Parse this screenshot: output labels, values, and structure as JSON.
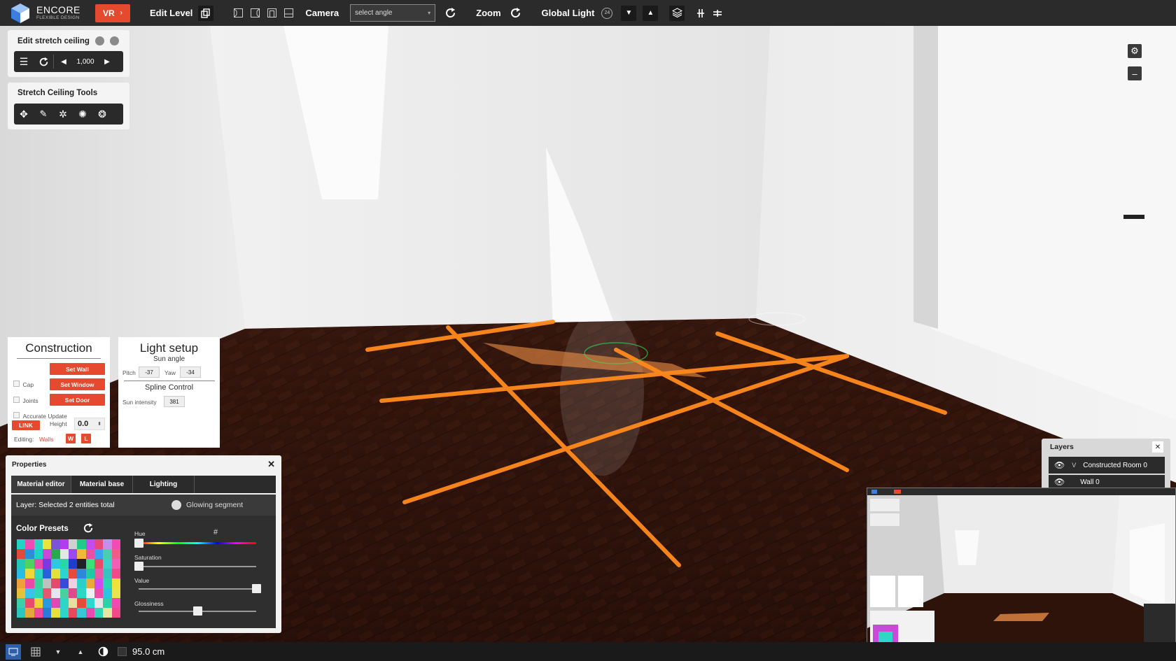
{
  "app": {
    "name": "ENCORE",
    "tagline": "FLEXIBLE DESIGN"
  },
  "toolbar": {
    "vr_label": "VR",
    "edit_level_label": "Edit Level",
    "camera_label": "Camera",
    "camera_select_value": "select angle",
    "zoom_label": "Zoom",
    "global_light_label": "Global Light",
    "global_light_badge": "24"
  },
  "edit_stretch": {
    "title": "Edit stretch ceiling",
    "value": "1,000"
  },
  "stretch_tools": {
    "title": "Stretch Ceiling Tools"
  },
  "construction": {
    "title": "Construction",
    "set_wall": "Set Wall",
    "set_window": "Set Window",
    "set_door": "Set Door",
    "cap_label": "Cap",
    "joints_label": "Joints",
    "accurate_label": "Accurate Update",
    "link_label": "LINK",
    "height_label": "Height",
    "height_value": "0.0",
    "editing_label": "Editing:",
    "editing_value": "Walls",
    "w_label": "W",
    "l_label": "L"
  },
  "light_setup": {
    "title": "Light setup",
    "sun_angle": "Sun angle",
    "pitch_label": "Pitch",
    "pitch_value": "-37",
    "yaw_label": "Yaw",
    "yaw_value": "-34",
    "spline_label": "Spline Control",
    "sun_intensity_label": "Sun intensity",
    "sun_intensity_value": "381"
  },
  "properties": {
    "title": "Properties",
    "tabs": [
      "Material editor",
      "Material base",
      "Lighting"
    ],
    "layer_text": "Layer: Selected 2 entities total",
    "glowing_label": "Glowing segment",
    "color_presets_label": "Color Presets",
    "hue_label": "Hue",
    "hash_label": "#",
    "saturation_label": "Saturation",
    "value_label": "Value",
    "glossiness_label": "Glossiness",
    "hue": 0.0,
    "saturation": 0.0,
    "value": 1.0,
    "glossiness": 0.5,
    "swatches": [
      "#1fd6c6",
      "#f04bb5",
      "#2fd2c7",
      "#e8e43a",
      "#7a53d8",
      "#b33cf0",
      "#d0d0d0",
      "#21c98a",
      "#c74af0",
      "#e64878",
      "#c58eea",
      "#f24bb3",
      "#e34a3a",
      "#2a8fd8",
      "#1ed5c3",
      "#c94ad8",
      "#2aa94a",
      "#e6e6e6",
      "#9c4af0",
      "#f5b63a",
      "#e84fa8",
      "#3aa2f0",
      "#47d0b0",
      "#f05b8a",
      "#23c9b8",
      "#50d25f",
      "#e64bb0",
      "#7a3ae0",
      "#31c7e0",
      "#2ad6a8",
      "#1f3ed0",
      "#20202a",
      "#3ae078",
      "#e84a6a",
      "#3dd1c9",
      "#f05fb5",
      "#2bbbe6",
      "#f0d63a",
      "#2fd6c0",
      "#2a60d8",
      "#e6e03a",
      "#2fd3d0",
      "#e64a3a",
      "#2a8ad8",
      "#20c9a0",
      "#e65aa8",
      "#34c5c0",
      "#f04a8a",
      "#f0a03a",
      "#e84aa6",
      "#3ad29a",
      "#c0c0c0",
      "#e64a6a",
      "#3a4ad8",
      "#f0d0e0",
      "#29d0c8",
      "#e8a83a",
      "#d04af0",
      "#2ad6b0",
      "#f0e03a",
      "#e8c03a",
      "#3ac2e8",
      "#2fd6b6",
      "#e6586e",
      "#e6e6f0",
      "#4ad0a0",
      "#e04a8a",
      "#2fd6c6",
      "#eeeeee",
      "#f04aa8",
      "#2ac6e0",
      "#e6e64a",
      "#3ad0a8",
      "#e84a6a",
      "#f0d03a",
      "#2a9ad8",
      "#e04ab0",
      "#2fd6c6",
      "#e6e0a0",
      "#e64a3a",
      "#2fd6ce",
      "#e6e6e6",
      "#2fd0a8",
      "#f04ab0",
      "#29c7c0",
      "#e4a83a",
      "#f04aa0",
      "#2a7ad8",
      "#e6e03a",
      "#2fd6c6",
      "#e64a5a",
      "#38c9d8",
      "#e84ab0",
      "#2fd6b8",
      "#e6e6a0",
      "#f04a8a"
    ]
  },
  "layers": {
    "title": "Layers",
    "items": [
      {
        "label": "Constructed Room 0",
        "prefix": "V"
      },
      {
        "label": "Wall 0",
        "prefix": ""
      }
    ]
  },
  "bottom": {
    "measure": "95.0 cm"
  },
  "colors": {
    "accent": "#e64a2e",
    "guide_line": "#ff8a1c",
    "floor": "#2a120c"
  }
}
